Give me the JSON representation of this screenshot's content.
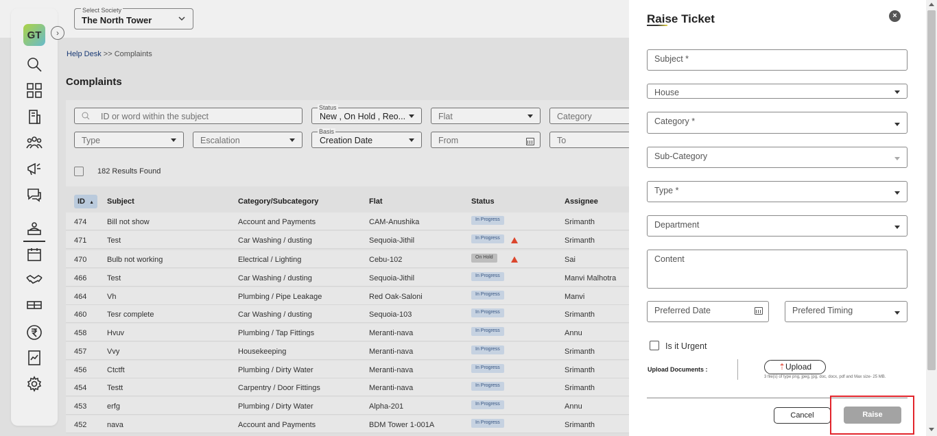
{
  "header": {
    "society_label": "Select Society",
    "society_value": "The North Tower"
  },
  "breadcrumb": {
    "root": "Help Desk",
    "separator": " >> ",
    "current": "Complaints"
  },
  "page_title": "Complaints",
  "filters": {
    "search_placeholder": "ID or word within the subject",
    "status_label": "Status",
    "status_value": "New , On Hold , Reo...",
    "flat_placeholder": "Flat",
    "category_placeholder": "Category",
    "type_placeholder": "Type",
    "escalation_placeholder": "Escalation",
    "basis_label": "Basis",
    "basis_value": "Creation Date",
    "from_placeholder": "From",
    "to_placeholder": "To"
  },
  "results_text": "182 Results Found",
  "table": {
    "headers": {
      "id": "ID",
      "sort_icon": "▲",
      "subject": "Subject",
      "category": "Category/Subcategory",
      "flat": "Flat",
      "status": "Status",
      "assignee": "Assignee"
    },
    "rows": [
      {
        "id": "474",
        "subject": "Bill not show",
        "category": "Account and Payments",
        "flat": "CAM-Anushika",
        "status": "In Progress",
        "assignee": "Srimanth"
      },
      {
        "id": "471",
        "subject": "Test",
        "category": "Car Washing / dusting",
        "flat": "Sequoia-Jithil",
        "status": "In Progress",
        "assignee": "Srimanth"
      },
      {
        "id": "470",
        "subject": "Bulb not working",
        "category": "Electrical / Lighting",
        "flat": "Cebu-102",
        "status": "On Hold",
        "assignee": "Sai"
      },
      {
        "id": "466",
        "subject": "Test",
        "category": "Car Washing / dusting",
        "flat": "Sequoia-Jithil",
        "status": "In Progress",
        "assignee": "Manvi Malhotra"
      },
      {
        "id": "464",
        "subject": "Vh",
        "category": "Plumbing / Pipe Leakage",
        "flat": "Red Oak-Saloni",
        "status": "In Progress",
        "assignee": "Manvi"
      },
      {
        "id": "460",
        "subject": "Tesr complete",
        "category": "Car Washing / dusting",
        "flat": "Sequoia-103",
        "status": "In Progress",
        "assignee": "Srimanth"
      },
      {
        "id": "458",
        "subject": "Hvuv",
        "category": "Plumbing / Tap Fittings",
        "flat": "Meranti-nava",
        "status": "In Progress",
        "assignee": "Annu"
      },
      {
        "id": "457",
        "subject": "Vvy",
        "category": "Housekeeping",
        "flat": "Meranti-nava",
        "status": "In Progress",
        "assignee": "Srimanth"
      },
      {
        "id": "456",
        "subject": "Ctctft",
        "category": "Plumbing / Dirty Water",
        "flat": "Meranti-nava",
        "status": "In Progress",
        "assignee": "Srimanth"
      },
      {
        "id": "454",
        "subject": "Testt",
        "category": "Carpentry / Door Fittings",
        "flat": "Meranti-nava",
        "status": "In Progress",
        "assignee": "Srimanth"
      },
      {
        "id": "453",
        "subject": "erfg",
        "category": "Plumbing / Dirty Water",
        "flat": "Alpha-201",
        "status": "In Progress",
        "assignee": "Annu"
      },
      {
        "id": "452",
        "subject": "nava",
        "category": "Account and Payments",
        "flat": "BDM Tower 1-001A",
        "status": "In Progress",
        "assignee": "Srimanth"
      }
    ]
  },
  "drawer": {
    "title": "Raise Ticket",
    "close_icon": "×",
    "subject_label": "Subject *",
    "house_label": "House",
    "category_label": "Category *",
    "subcategory_label": "Sub-Category",
    "type_label": "Type *",
    "department_label": "Department",
    "content_label": "Content",
    "preferred_date_label": "Preferred Date",
    "preferred_timing_label": "Prefered Timing",
    "urgent_label": "Is it Urgent",
    "upload_label": "Upload Documents :",
    "upload_button": "Upload",
    "upload_note": "3 file(s) of type png, jpeg, jpg, doc, docx, pdf and Max size- 25 MB.",
    "cancel_button": "Cancel",
    "raise_button": "Raise"
  },
  "logo_text": "GT",
  "collapse_icon": "›",
  "colors": {
    "accent_highlight": "#e2242b",
    "raise_disabled": "#a3a3a3",
    "badge_in_progress": "#d3e0f0",
    "warning": "#e94b30"
  }
}
